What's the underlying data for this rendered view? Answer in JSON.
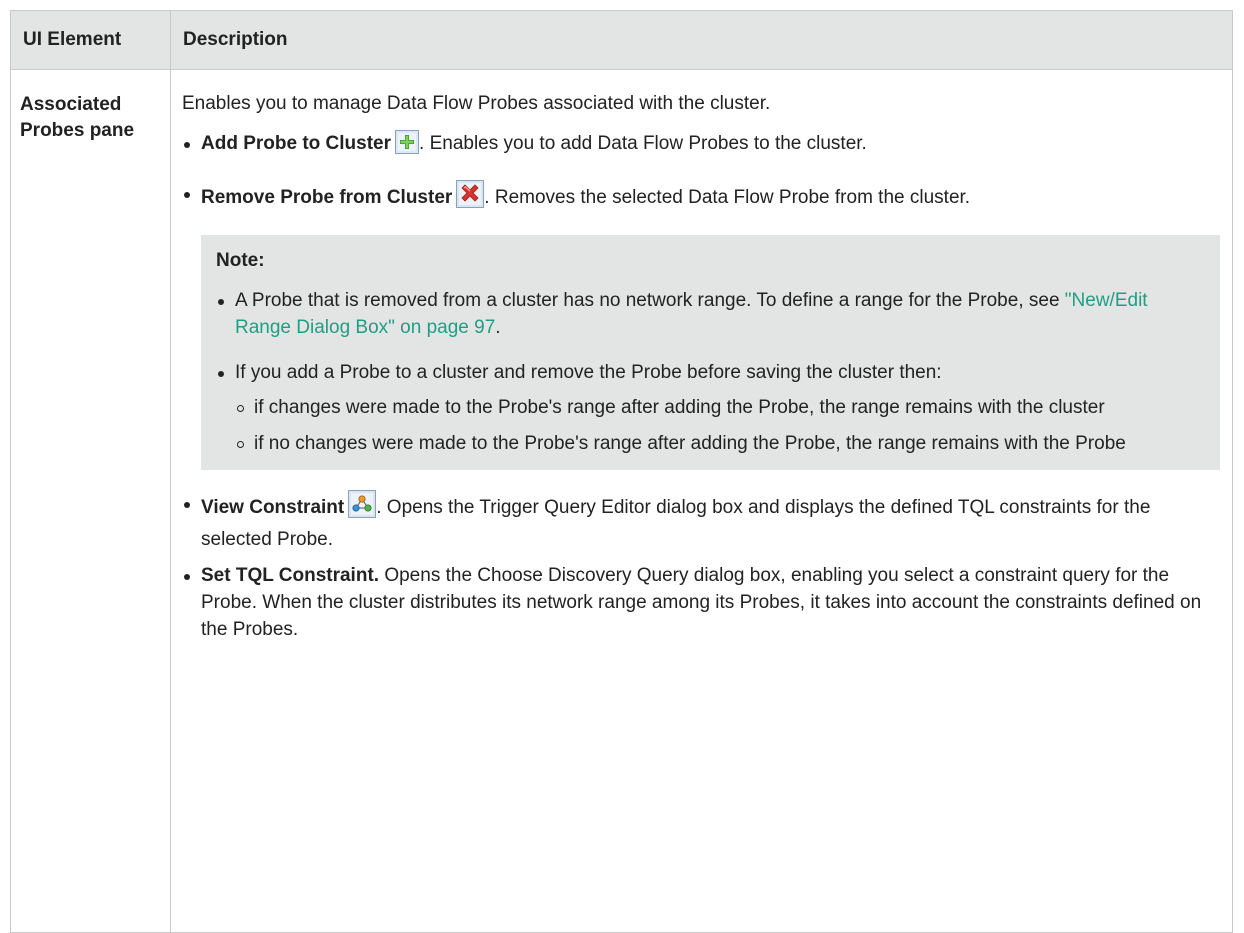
{
  "table": {
    "header_element": "UI Element",
    "header_description": "Description"
  },
  "row": {
    "element_name": "Associated Probes pane",
    "intro": "Enables you to manage Data Flow Probes associated with the cluster.",
    "items": [
      {
        "title": "Add Probe to Cluster",
        "icon": "add-plus-icon",
        "text": ". Enables you to add Data Flow Probes to the cluster."
      },
      {
        "title": "Remove Probe from Cluster",
        "icon": "remove-x-icon",
        "text": ". Removes the selected Data Flow Probe from the cluster."
      }
    ],
    "note": {
      "title": "Note:",
      "point1_text": "A Probe that is removed from a cluster has no network range. To define a range for the Probe, see ",
      "point1_link": "\"New/Edit Range Dialog Box\" on page 97",
      "point1_end": ".",
      "point2_text": "If you add a Probe to a cluster and remove the Probe before saving the cluster then:",
      "subpoints": [
        "if changes were made to the Probe's range after adding the Probe, the range remains with the cluster",
        "if no changes were made to the Probe's range after adding the Probe, the range remains with the Probe"
      ]
    },
    "items2": [
      {
        "title": "View Constraint",
        "icon": "view-constraint-icon",
        "text": ". Opens the Trigger Query Editor dialog box and displays the defined TQL constraints for the selected Probe."
      },
      {
        "title": "Set TQL Constraint.",
        "text": " Opens the Choose Discovery Query dialog box, enabling you select a constraint query for the Probe. When the cluster distributes its network range among its Probes, it takes into account the constraints defined on the Probes."
      }
    ]
  },
  "colors": {
    "header_bg": "#e3e5e4",
    "note_bg": "#e3e5e4",
    "link": "#1f9e85",
    "border": "#c9c9c9"
  }
}
